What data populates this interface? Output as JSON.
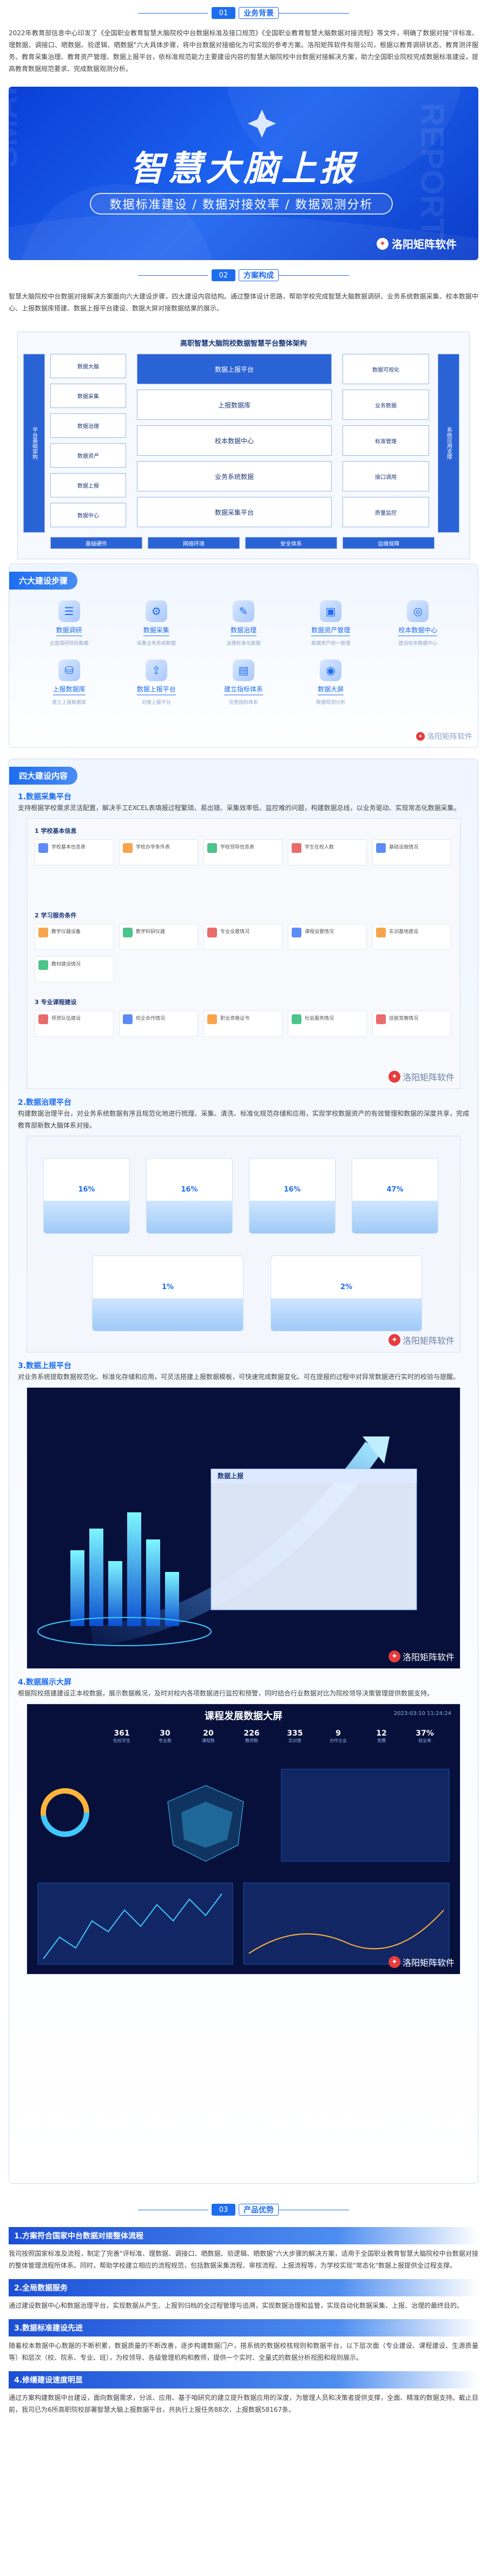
{
  "sections": {
    "s1": {
      "num": "01",
      "title": "业务背景"
    },
    "s2": {
      "num": "02",
      "title": "方案构成"
    },
    "s3": {
      "num": "03",
      "title": "产品优势"
    }
  },
  "background_text": "2022年教育部信息中心印发了《全国职业教育智慧大脑院校中台数据标准及接口规范》《全国职业教育智慧大脑数据对接流程》等文件，明确了数据对接\"评标准、理数据、调接口、晒数据、验逻辑、晒数据\"六大具体步骤，将中台数据对接细化为可实现的参考方案。洛阳矩阵软件有限公司，根据以教育调研状态、教育测评服务、教育采集治理、教育资产管理、数据上报平台，依标准规范能力主要建设内容的智慧大脑院校中台数据对接解决方案，助力全国职业院校完成数据标准建设，提高教育数据规范要求、完成数据观测分析。",
  "banner": {
    "ghost_left": "SMART",
    "ghost_right": "REPORT",
    "title": "智慧大脑上报",
    "subtitle": "数据标准建设 / 数据对接效率 / 数据观测分析",
    "brand": "洛阳矩阵软件"
  },
  "scheme_text": "智慧大脑院校中台数据对接解决方案面向六大建设步骤，四大建设内容结构。通过整体设计思路，帮助学校完成智慧大脑数据调研、业务系统数据采集、校本数据中心、上报数据库搭建、数据上报平台建设、数据大屏对接数据结果的展示。",
  "diagram": {
    "title": "高职智慧大脑院校数据智慧平台整体架构",
    "left_label": "平台基础架构",
    "left_items": [
      "数据大脑",
      "数据采集",
      "数据治理",
      "数据资产",
      "数据上报",
      "数据中心"
    ],
    "middle_items": [
      "数据上报平台",
      "上报数据库",
      "校本数据中心",
      "业务系统数据",
      "数据采集平台"
    ],
    "right_label": "系统应用支撑",
    "right_items": [
      "数据可视化",
      "业务数据",
      "标准管理",
      "接口调用",
      "质量监控"
    ],
    "bottom_items": [
      "基础硬件",
      "网络环境",
      "安全体系",
      "运维保障"
    ]
  },
  "six_steps": {
    "tag": "六大建设步骤",
    "items": [
      {
        "label": "数据调研",
        "sub": "全面调研院校数据"
      },
      {
        "label": "数据采集",
        "sub": "采集业务系统数据"
      },
      {
        "label": "数据治理",
        "sub": "治理标准化数据"
      },
      {
        "label": "数据资产管理",
        "sub": "数据资产统一管理"
      },
      {
        "label": "校本数据中心",
        "sub": "建设校本数据中心"
      },
      {
        "label": "上报数据库",
        "sub": "建立上报数据库"
      },
      {
        "label": "数据上报平台",
        "sub": "对接上报平台"
      },
      {
        "label": "建立指标体系",
        "sub": "完善指标体系"
      },
      {
        "label": "数据大屏",
        "sub": "数据观测分析"
      }
    ],
    "watermark": "洛阳矩阵软件"
  },
  "four_content": {
    "tag": "四大建设内容",
    "c1": {
      "title": "1.数据采集平台",
      "text": "支持根据学校需求灵活配置，解决手工EXCEL表填报过程繁琐、易出错、采集效率低、监控难的问题，构建数据总线，以业务驱动、实现常态化数据采集。",
      "groups": [
        "1 学校基本信息",
        "2 学习服务条件",
        "3 专业课程建设"
      ],
      "cards": [
        "学校基本信息表",
        "学校办学条件表",
        "学校领导信息表",
        "学生在校人数",
        "基础设施情况",
        "教学仪器设备",
        "教学科研仪器",
        "专业设置情况",
        "课程设置情况",
        "实训基地建设",
        "教材建设情况",
        "师资队伍建设",
        "校企合作情况",
        "职业资格证书",
        "社会服务情况",
        "技能竞赛情况"
      ],
      "watermark": "洛阳矩阵软件"
    },
    "c2": {
      "title": "2.数据治理平台",
      "text": "构建数据治理平台，对业务系统数据有序且规范化地进行梳理、采集、清洗、标准化规范存储和应用，实现学校数据资产的有效管理和数据的深度共享，完成教育部新数大脑体系对接。",
      "metrics": [
        "16%",
        "16%",
        "16%",
        "47%",
        "1%",
        "2%"
      ],
      "watermark": "洛阳矩阵软件"
    },
    "c3": {
      "title": "3.数据上报平台",
      "text": "对业务系统提取数据规范化、标准化存储和应用，可灵活搭建上报数据模板，可快速完成数据变化、可在提报的过程中对异常数据进行实时的校验与提醒。",
      "panel_title": "数据上报",
      "watermark": "洛阳矩阵软件"
    },
    "c4": {
      "title": "4.数据展示大屏",
      "text": "根据院校搭建建设正本校数据，展示数据概况，及时对校内各项数据进行监控和预警，同时结合行业数据对比为院校领导决策管理提供数据支持。",
      "screen_title": "课程发展数据大屏",
      "screen_time": "2023-03-10 11:24:24",
      "kpis": [
        {
          "v": "361",
          "l": "在校学生"
        },
        {
          "v": "30",
          "l": "专业数"
        },
        {
          "v": "20",
          "l": "课程数"
        },
        {
          "v": "226",
          "l": "教师数"
        },
        {
          "v": "335",
          "l": "实训室"
        },
        {
          "v": "9",
          "l": "合作企业"
        },
        {
          "v": "12",
          "l": "竞赛"
        },
        {
          "v": "37%",
          "l": "就业率"
        }
      ],
      "watermark": "洛阳矩阵软件"
    }
  },
  "advantages": [
    {
      "title": "1.方案符合国家中台数据对接整体流程",
      "text": "我司按照国家标准及流程，制定了完善\"评标准、理数据、调接口、晒数据、验逻辑、晒数据\"六大步骤的解决方案，适用于全国职业教育智慧大脑院校中台数据对接的整体管理流程所体系。同时，帮助学校建立相应的流程规范，包括数据采集流程、审核流程、上报流程等，为学校实现\"常态化\"数据上报提供全过程支撑。"
    },
    {
      "title": "2.全局数据服务",
      "text": "通过建设数据中心和数据治理平台，实现数据从产生、上报到归档的全过程管理与追溯，实现数据治理和监管，实现自动化数据采集、上报、治理的最终目的。"
    },
    {
      "title": "3.数据标准建设先进",
      "text": "随着校本数据中心数据的不断积累，数据质量的不断改善，逐步构建数据门户，搭系统的数据校核规则和数据平台，以下层次面（专业建设、课程建设、生源质量等）和层次（校、院系、专业、班），为校领导、各级管理机构和教师，提供一个实时、全量式的数据分析视图和规则展示。"
    },
    {
      "title": "4.修缮建设速度明显",
      "text": "通过方案构建数据中台建设，面向数据需求，分派、应用、基于咱研究的建立提升数据应用的深度，为管理人员和决策者提供支撑，全面、精准的数据支持。截止目前，我司已为6所高职院校部署智慧大脑上报数据平台，共执行上报任务88次，上报数据58167条。"
    }
  ]
}
